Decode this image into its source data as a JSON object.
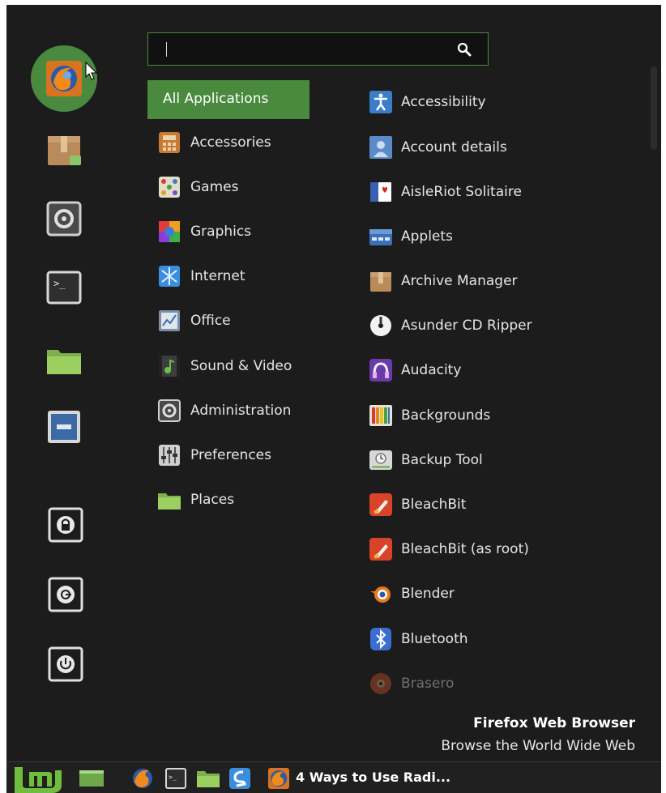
{
  "search": {
    "value": "",
    "placeholder": ""
  },
  "favorites": [
    {
      "name": "firefox-icon",
      "app": "Firefox"
    },
    {
      "name": "package-icon",
      "app": "Archive"
    },
    {
      "name": "system-settings-icon",
      "app": "Settings"
    },
    {
      "name": "terminal-icon",
      "app": "Terminal"
    },
    {
      "name": "folder-icon",
      "app": "Files"
    },
    {
      "name": "screen-icon",
      "app": "Display"
    },
    {
      "name": "lock-screen-icon",
      "app": "Lock Screen"
    },
    {
      "name": "logout-icon",
      "app": "Logout"
    },
    {
      "name": "power-icon",
      "app": "Shutdown"
    }
  ],
  "categories": [
    {
      "label": "All Applications"
    },
    {
      "label": "Accessories"
    },
    {
      "label": "Games"
    },
    {
      "label": "Graphics"
    },
    {
      "label": "Internet"
    },
    {
      "label": "Office"
    },
    {
      "label": "Sound & Video"
    },
    {
      "label": "Administration"
    },
    {
      "label": "Preferences"
    },
    {
      "label": "Places"
    }
  ],
  "apps": [
    {
      "label": "Accessibility"
    },
    {
      "label": "Account details"
    },
    {
      "label": "AisleRiot Solitaire"
    },
    {
      "label": "Applets"
    },
    {
      "label": "Archive Manager"
    },
    {
      "label": "Asunder CD Ripper"
    },
    {
      "label": "Audacity"
    },
    {
      "label": "Backgrounds"
    },
    {
      "label": "Backup Tool"
    },
    {
      "label": "BleachBit"
    },
    {
      "label": "BleachBit (as root)"
    },
    {
      "label": "Blender"
    },
    {
      "label": "Bluetooth"
    },
    {
      "label": "Brasero"
    }
  ],
  "description": {
    "title": "Firefox Web Browser",
    "text": "Browse the World Wide Web"
  },
  "panel": {
    "task_label": "4 Ways to Use Radi..."
  },
  "colors": {
    "accent": "#4a8a3f",
    "background": "#1c1c1c",
    "text": "#e6e6e6"
  }
}
